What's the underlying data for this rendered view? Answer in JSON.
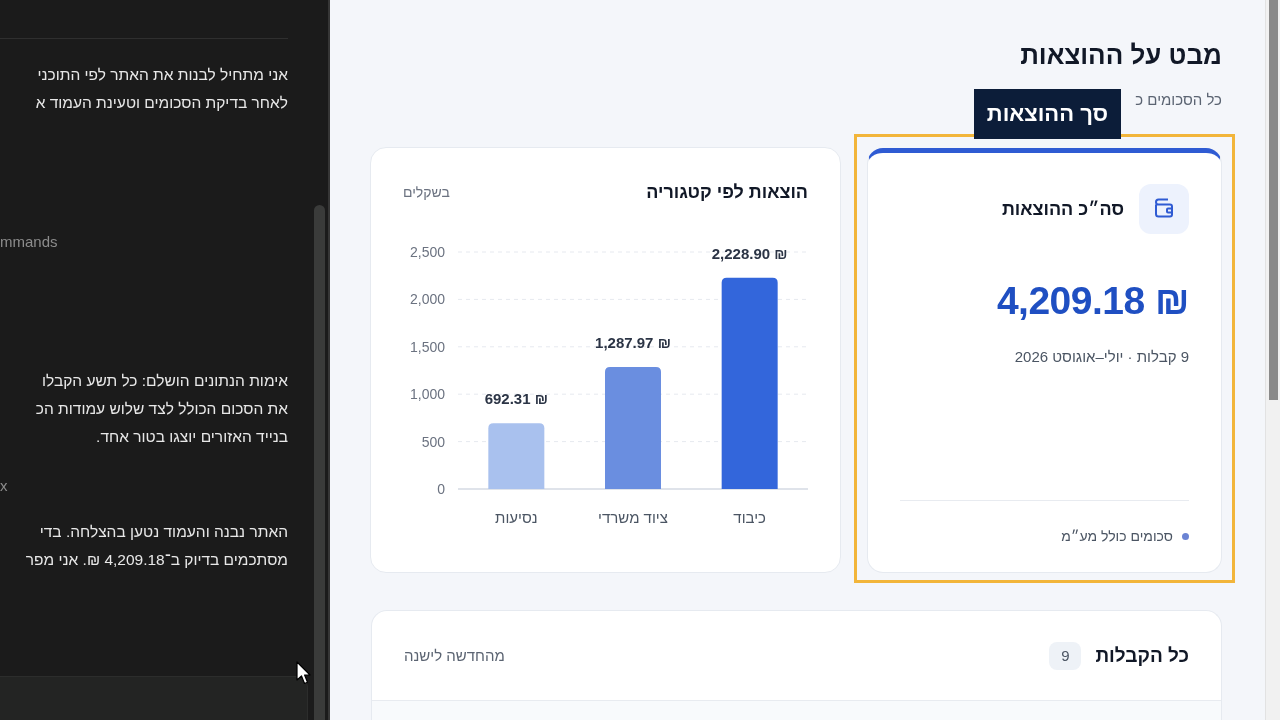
{
  "chat_panel": {
    "messages": [
      {
        "kind": "text",
        "lines": [
          "אני מתחיל לבנות את האתר לפי התוכני",
          "לאחר בדיקת הסכומים וטעינת העמוד א"
        ]
      },
      {
        "kind": "tool",
        "text": "mmands"
      },
      {
        "kind": "text",
        "lines": [
          "אימות הנתונים הושלם: כל תשע הקבלו",
          "את הסכום הכולל לצד שלוש עמודות הכ",
          "בנייד האזורים יוצגו בטור אחד."
        ]
      },
      {
        "kind": "tool",
        "text": "x"
      },
      {
        "kind": "text",
        "lines": [
          "האתר נבנה והעמוד נטען בהצלחה. בדי",
          "מסתכמים בדיוק ב־4,209.18 ₪. אני מפר"
        ]
      }
    ]
  },
  "page": {
    "title": "מבט על ההוצאות",
    "subtitle": "כל הסכומים כ"
  },
  "summary_card": {
    "highlighted": true,
    "highlight_label": "סך ההוצאות",
    "label": "סה״כ ההוצאות",
    "amount": "₪ 4,209.18",
    "details": "9 קבלות · יולי–אוגוסט 2026",
    "note": "סכומים כולל מע״מ"
  },
  "category_card": {
    "title": "הוצאות לפי קטגוריה",
    "unit": "בשקלים",
    "chart_data": {
      "type": "bar",
      "categories": [
        "נסיעות",
        "ציוד משרדי",
        "כיבוד"
      ],
      "values": [
        692.31,
        1287.97,
        2228.9
      ],
      "colors": [
        "#a9c1ee",
        "#6a8ee0",
        "#3366db"
      ],
      "value_labels": [
        "₪ 692.31",
        "₪ 1,287.97",
        "₪ 2,228.90"
      ],
      "ylim": [
        0,
        2500
      ],
      "yticks": [
        {
          "value": 0,
          "label": "0"
        },
        {
          "value": 500,
          "label": "500"
        },
        {
          "value": 1000,
          "label": "1,000"
        },
        {
          "value": 1500,
          "label": "1,500"
        },
        {
          "value": 2000,
          "label": "2,000"
        },
        {
          "value": 2500,
          "label": "2,500"
        }
      ],
      "grid": true
    }
  },
  "receipts": {
    "title": "כל הקבלות",
    "count": "9",
    "sort": "מהחדשה לישנה"
  }
}
